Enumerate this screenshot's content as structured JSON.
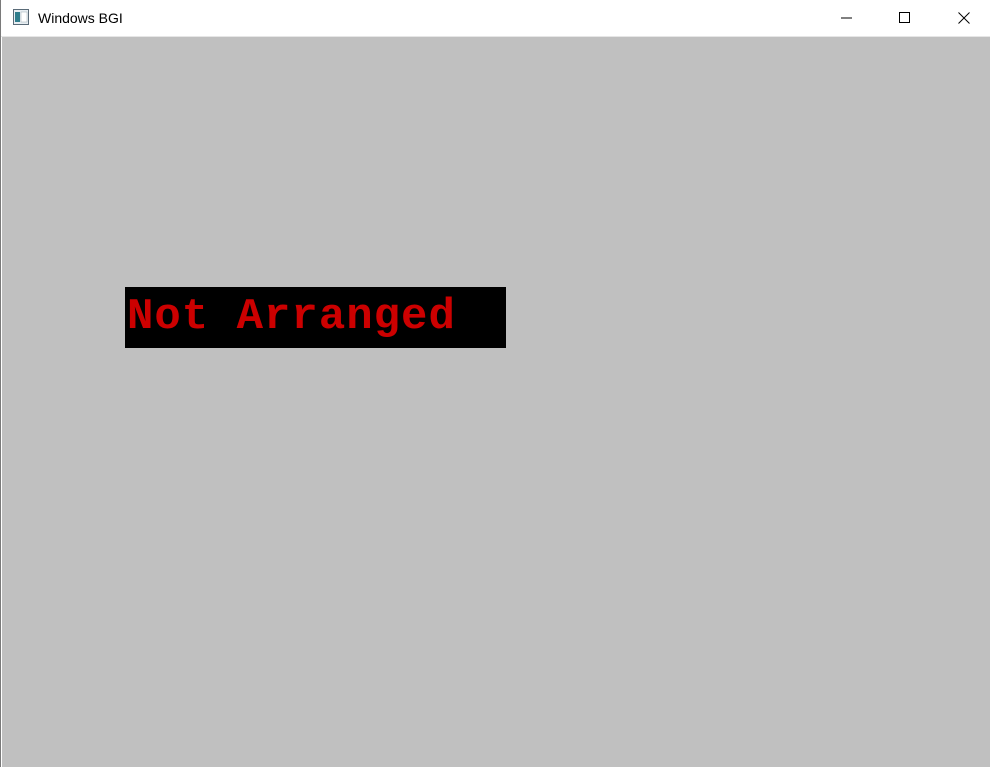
{
  "window": {
    "title": "Windows BGI",
    "icon": "app-window-icon",
    "controls": {
      "minimize": "minimize-icon",
      "maximize": "maximize-icon",
      "close": "close-icon"
    }
  },
  "canvas": {
    "background_color": "#c0c0c0",
    "status_text": "Not Arranged",
    "status_text_color": "#cc0000",
    "status_background_color": "#000000"
  }
}
